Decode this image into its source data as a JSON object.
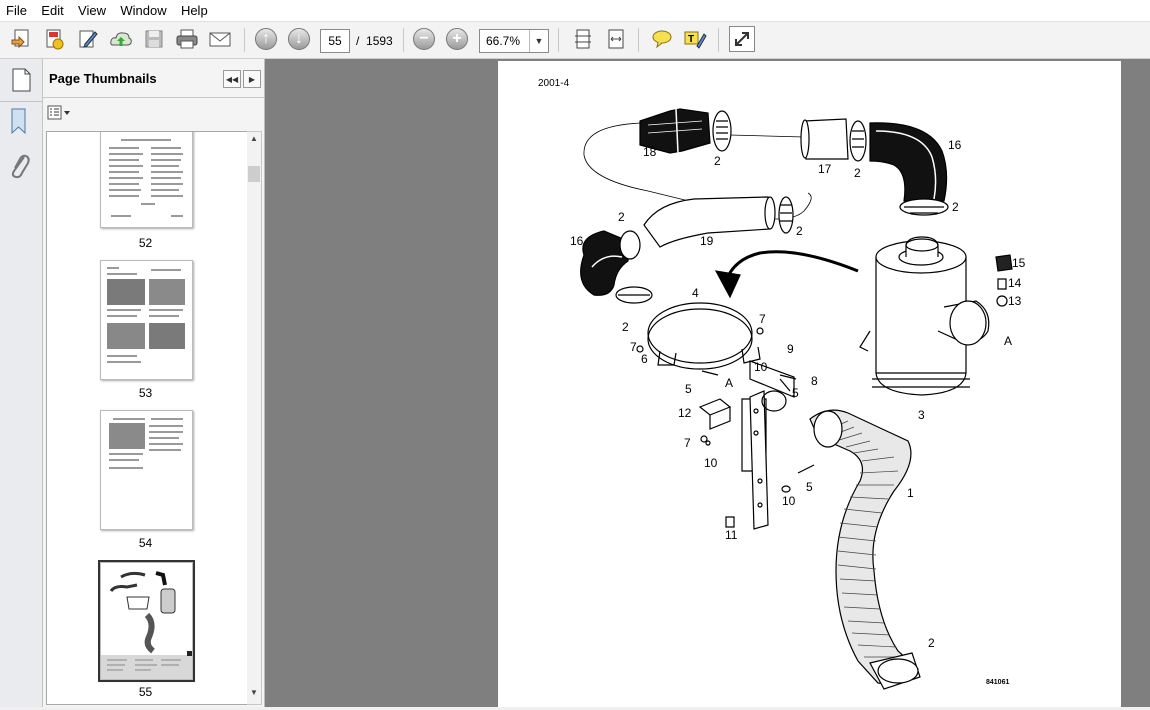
{
  "menu": [
    "File",
    "Edit",
    "View",
    "Window",
    "Help"
  ],
  "toolbar": {
    "page_current": "55",
    "page_separator": "/",
    "page_total": "1593",
    "zoom": "66.7%"
  },
  "icons": [
    "create-icon",
    "print-pages-icon",
    "edit-icon",
    "upload-icon",
    "save-icon",
    "print-icon",
    "email-icon",
    "prev-page-icon",
    "next-page-icon",
    "zoom-out-icon",
    "zoom-in-icon",
    "fit-page-icon",
    "fit-width-icon",
    "comment-icon",
    "highlight-icon",
    "expand-icon",
    "pages-icon",
    "attachment-icon"
  ],
  "panel": {
    "title": "Page Thumbnails"
  },
  "thumbnails": [
    {
      "label": "52"
    },
    {
      "label": "53"
    },
    {
      "label": "54"
    },
    {
      "label": "55"
    }
  ],
  "document": {
    "header": "2001-4",
    "figure_code": "841061",
    "callouts": [
      "18",
      "2",
      "17",
      "2",
      "16",
      "2",
      "2",
      "19",
      "2",
      "16",
      "4",
      "7",
      "15",
      "14",
      "13",
      "2",
      "7",
      "6",
      "9",
      "A",
      "10",
      "8",
      "5",
      "A",
      "5",
      "3",
      "12",
      "7",
      "10",
      "5",
      "1",
      "10",
      "11",
      "2"
    ]
  }
}
